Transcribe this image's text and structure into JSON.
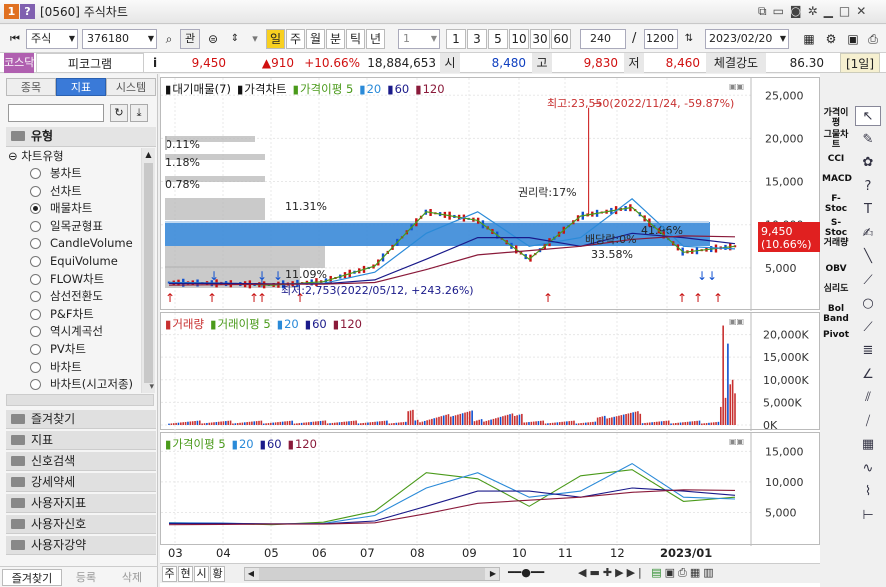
{
  "window": {
    "icon1": "1",
    "icon2": "?",
    "title": "[0560] 주식차트"
  },
  "toolbar": {
    "market": "주식",
    "code": "376180",
    "search_btn": "관",
    "period_buttons": [
      "일",
      "주",
      "월",
      "분",
      "틱",
      "년"
    ],
    "interval_select": "1",
    "interval_buttons": [
      "1",
      "3",
      "5",
      "10",
      "30",
      "60"
    ],
    "count1": "240",
    "count2": "1200",
    "date": "2023/02/20"
  },
  "quote": {
    "market_badge": "코스닥",
    "name": "피코그램",
    "info": "i",
    "price": "9,450",
    "change": "▲910",
    "rate": "+10.66%",
    "volume": "18,884,653",
    "open_label": "시",
    "open": "8,480",
    "high_label": "고",
    "high": "9,830",
    "low_label": "저",
    "low": "8,460",
    "strength_label": "체결강도",
    "strength": "86.30",
    "period_badge": "[1일]"
  },
  "left_panel": {
    "tabs": [
      "종목",
      "지표",
      "시스템"
    ],
    "section_title": "유형",
    "tree_root": "차트유형",
    "items": [
      "봉차트",
      "선차트",
      "매물차트",
      "일목균형표",
      "CandleVolume",
      "EquiVolume",
      "FLOW차트",
      "삼선전환도",
      "P&F차트",
      "역시계곡선",
      "PV차트",
      "바차트",
      "바차트(시고저종)"
    ],
    "selected_index": 2,
    "folders": [
      "즐겨찾기",
      "지표",
      "신호검색",
      "강세약세",
      "사용자지표",
      "사용자신호",
      "사용자강약"
    ],
    "bottom_tabs": [
      "즐겨찾기",
      "등록",
      "삭제"
    ]
  },
  "chart": {
    "panel1_legend": [
      "대기매물(7)",
      "가격차트",
      "가격이평 5",
      "20",
      "60",
      "120"
    ],
    "panel2_legend": [
      "거래량",
      "거래이평 5",
      "20",
      "60",
      "120"
    ],
    "panel3_legend": [
      "가격이평 5",
      "20",
      "60",
      "120"
    ],
    "colors": {
      "ma5": "#4a9a1a",
      "ma20": "#2a8ad8",
      "ma60": "#1a1a8a",
      "ma120": "#8a1a3a",
      "volume": "#c83030",
      "supply": "#b8b8b8",
      "supply_hi": "#3a8ad8",
      "up": "#c81010",
      "down": "#1050d0"
    },
    "supply_labels": [
      "0.11%",
      "1.18%",
      "0.78%",
      "11.31%",
      "41.96%",
      "33.58%",
      "11.09%"
    ],
    "annotations": {
      "high": "최고:23,550(2022/11/24, -59.87%)",
      "low": "최저:2,753(2022/05/12, +243.26%)",
      "rights": "권리락:17%",
      "dividend": "배당락:0%"
    },
    "price_axis": [
      "25,000",
      "20,000",
      "15,000",
      "10,000",
      "5,000"
    ],
    "current_price": "9,450",
    "current_rate": "(10.66%)",
    "volume_axis": [
      "20,000K",
      "15,000K",
      "10,000K",
      "5,000K",
      "0K"
    ],
    "ma_axis": [
      "15,000",
      "10,000",
      "5,000"
    ],
    "x_axis": [
      "03",
      "04",
      "05",
      "06",
      "07",
      "08",
      "09",
      "10",
      "11",
      "12",
      "2023/01"
    ],
    "bottom_buttons": [
      "주",
      "현",
      "시",
      "황"
    ]
  },
  "right_tools": {
    "labels": [
      "가격이평",
      "그물차트",
      "CCI",
      "MACD",
      "F-Stoc",
      "S-Stoc",
      "거래량",
      "OBV",
      "심리도",
      "Bol Band",
      "Pivot"
    ],
    "icons": [
      "cursor-icon",
      "eraser-icon",
      "shape-icon",
      "question-icon",
      "text-icon",
      "pen-icon",
      "line-icon",
      "ray-icon",
      "circle-icon",
      "trend-icon",
      "fibo-icon",
      "angle-icon",
      "channel-icon",
      "andrews-icon",
      "gann-icon",
      "wave-icon",
      "cycle-icon",
      "ruler-icon"
    ]
  },
  "chart_data": {
    "type": "line",
    "x": [
      "2022-03",
      "2022-04",
      "2022-05",
      "2022-06",
      "2022-07",
      "2022-08",
      "2022-09",
      "2022-10",
      "2022-11",
      "2022-12",
      "2023-01",
      "2023-02"
    ],
    "series": [
      {
        "name": "가격이평 5",
        "values": [
          3300,
          3200,
          3000,
          3400,
          5200,
          11500,
          10500,
          6000,
          11000,
          12000,
          6800,
          7500
        ]
      },
      {
        "name": "20",
        "values": [
          3300,
          3250,
          3100,
          3200,
          4500,
          9000,
          11500,
          7500,
          8500,
          13000,
          7500,
          7200
        ]
      },
      {
        "name": "60",
        "values": [
          3200,
          3200,
          3150,
          3150,
          3600,
          6000,
          8500,
          8500,
          7500,
          9000,
          8500,
          7800
        ]
      },
      {
        "name": "120",
        "values": [
          3000,
          3050,
          3100,
          3100,
          3300,
          4800,
          6500,
          7000,
          7500,
          8300,
          8700,
          8600
        ]
      }
    ],
    "ylim": [
      0,
      27000
    ],
    "high": {
      "value": 23550,
      "date": "2022-11-24"
    },
    "low": {
      "value": 2753,
      "date": "2022-05-12"
    }
  }
}
